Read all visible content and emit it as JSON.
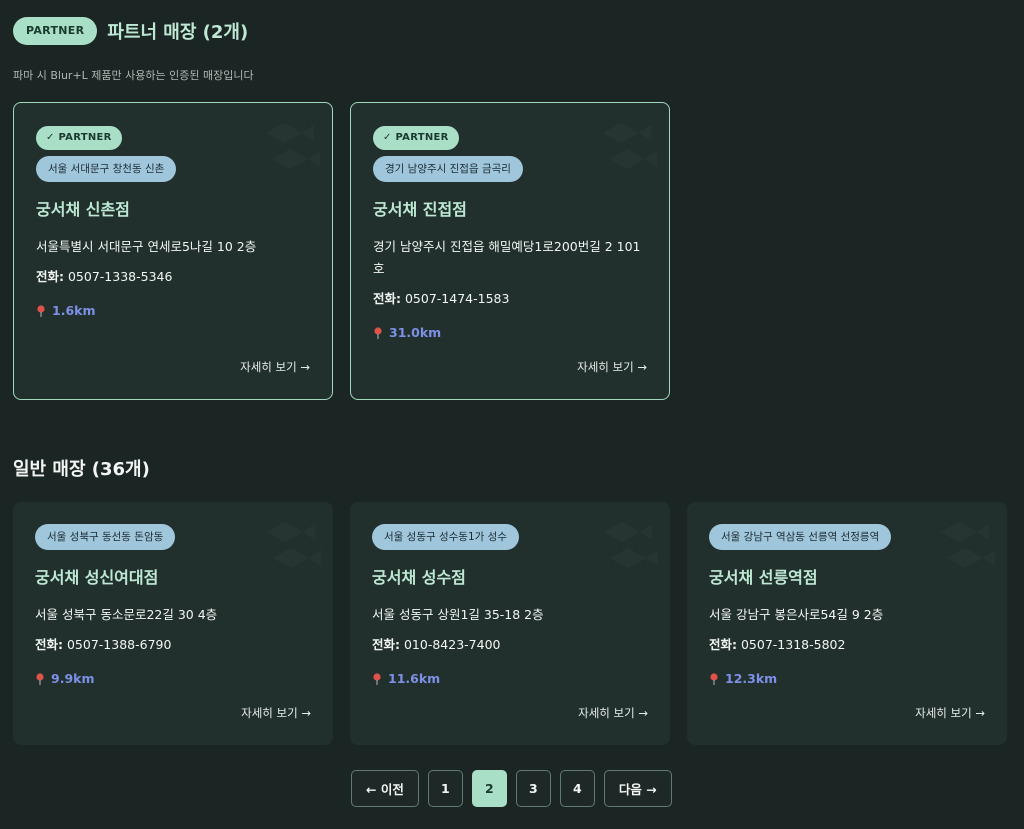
{
  "partner_section": {
    "badge": "PARTNER",
    "title": "파트너 매장 (2개)",
    "description": "파마 시 Blur+L 제품만 사용하는 인증된 매장입니다"
  },
  "partner_stores": [
    {
      "badge": "✓ PARTNER",
      "location_tag": "서울 서대문구 창천동 신촌",
      "name": "궁서채 신촌점",
      "address": "서울특별시 서대문구 연세로5나길 10 2층",
      "phone_label": "전화:",
      "phone": "0507-1338-5346",
      "distance": "1.6km",
      "detail": "자세히 보기 →"
    },
    {
      "badge": "✓ PARTNER",
      "location_tag": "경기 남양주시 진접읍 금곡리",
      "name": "궁서채 진접점",
      "address": "경기 남양주시 진접읍 해밀예당1로200번길 2 101호",
      "phone_label": "전화:",
      "phone": "0507-1474-1583",
      "distance": "31.0km",
      "detail": "자세히 보기 →"
    }
  ],
  "general_section": {
    "title": "일반 매장 (36개)"
  },
  "general_stores": [
    {
      "location_tag": "서울 성북구 동선동 돈암동",
      "name": "궁서채 성신여대점",
      "address": "서울 성북구 동소문로22길 30 4층",
      "phone_label": "전화:",
      "phone": "0507-1388-6790",
      "distance": "9.9km",
      "detail": "자세히 보기 →"
    },
    {
      "location_tag": "서울 성동구 성수동1가 성수",
      "name": "궁서채 성수점",
      "address": "서울 성동구 상원1길 35-18 2층",
      "phone_label": "전화:",
      "phone": "010-8423-7400",
      "distance": "11.6km",
      "detail": "자세히 보기 →"
    },
    {
      "location_tag": "서울 강남구 역삼동 선릉역 선정릉역",
      "name": "궁서채 선릉역점",
      "address": "서울 강남구 봉은사로54길 9 2층",
      "phone_label": "전화:",
      "phone": "0507-1318-5802",
      "distance": "12.3km",
      "detail": "자세히 보기 →"
    }
  ],
  "pagination": {
    "prev": "← 이전",
    "pages": [
      "1",
      "2",
      "3",
      "4"
    ],
    "current": "2",
    "next": "다음 →"
  },
  "colors": {
    "background": "#1b2523",
    "card": "#22302d",
    "accent_mint": "#a9dfc6",
    "location_tag": "#9fc6da",
    "distance": "#7c90e6"
  },
  "icons": {
    "pin": "map-pin-icon",
    "pattern": "fish-pattern-icon"
  }
}
